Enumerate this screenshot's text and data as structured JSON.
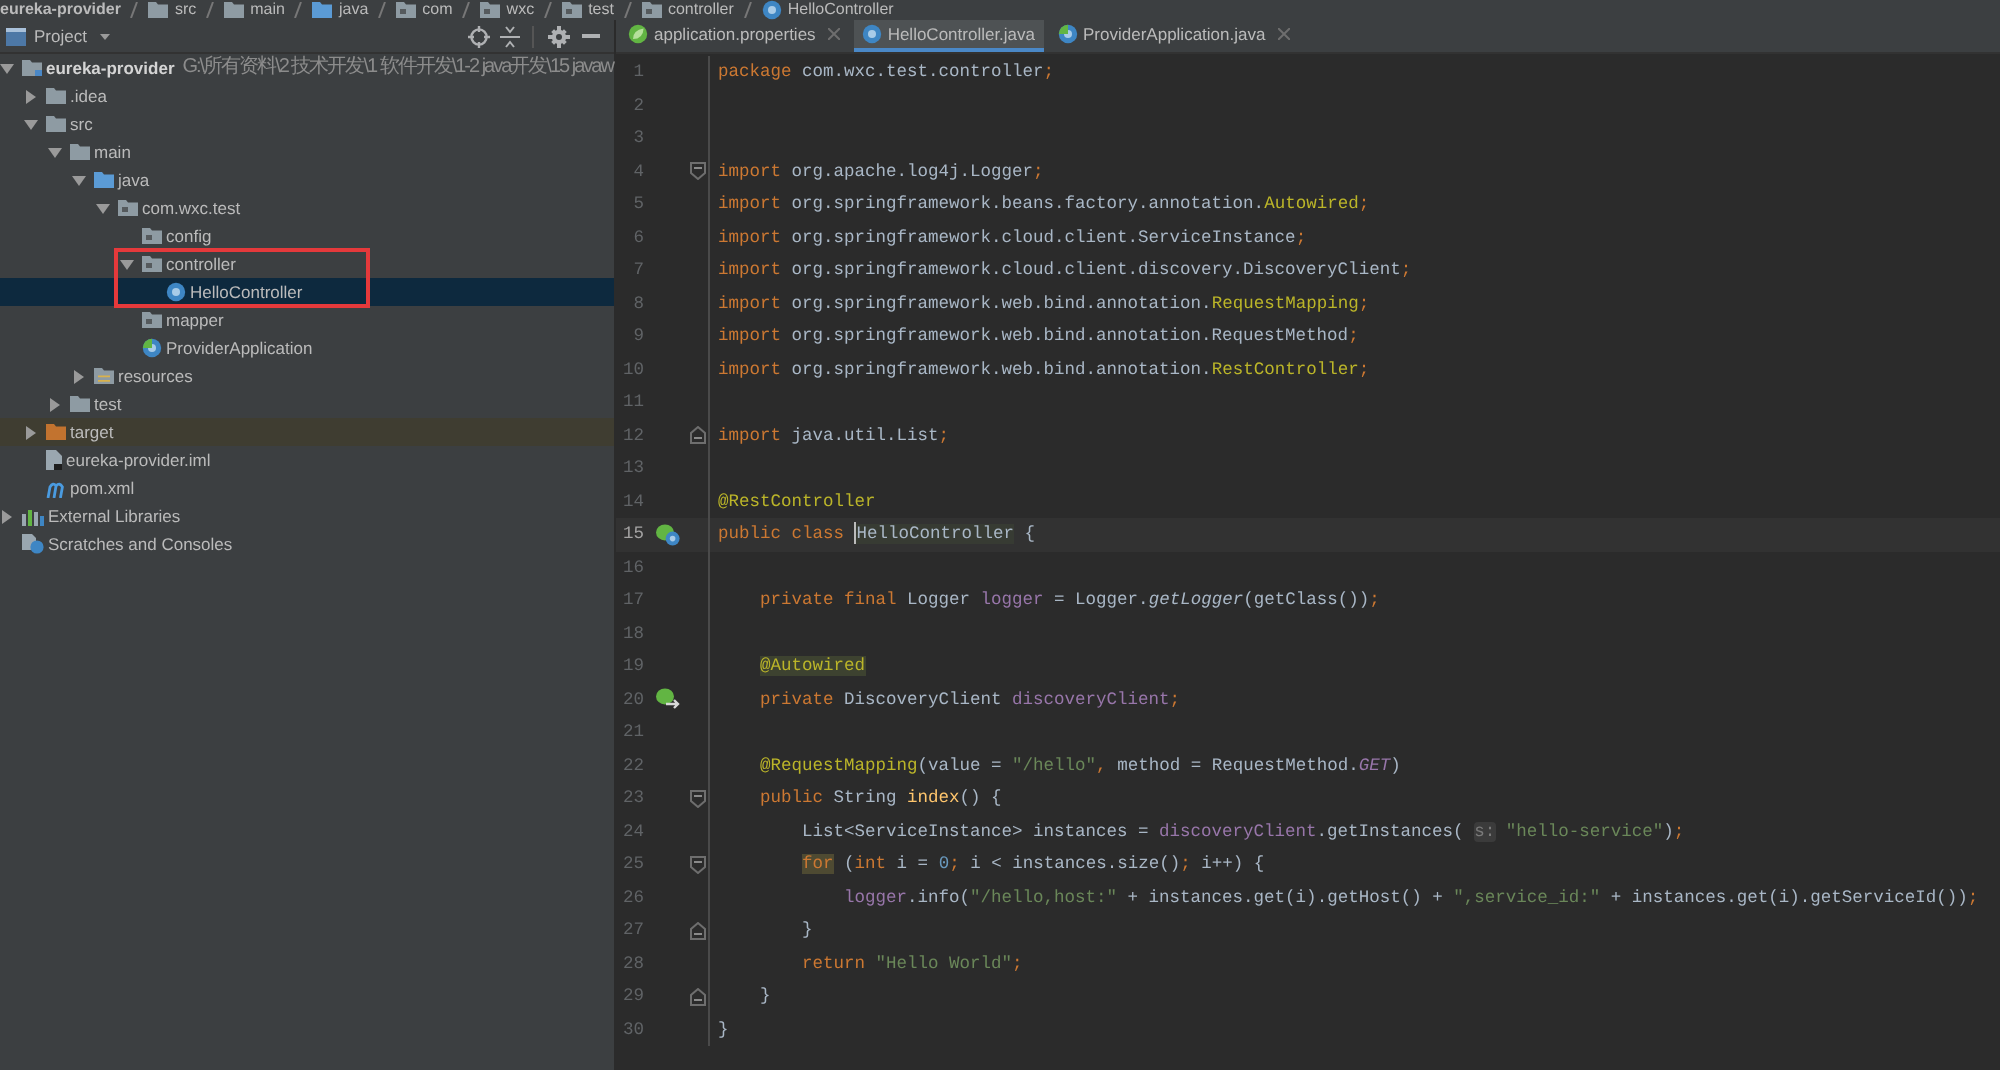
{
  "breadcrumb": [
    {
      "label": "eureka-provider",
      "kind": "module"
    },
    {
      "label": "src",
      "kind": "folder"
    },
    {
      "label": "main",
      "kind": "folder"
    },
    {
      "label": "java",
      "kind": "source"
    },
    {
      "label": "com",
      "kind": "package"
    },
    {
      "label": "wxc",
      "kind": "package"
    },
    {
      "label": "test",
      "kind": "package"
    },
    {
      "label": "controller",
      "kind": "package"
    },
    {
      "label": "HelloController",
      "kind": "class"
    }
  ],
  "project_panel": {
    "title": "Project",
    "tree": [
      {
        "label": "eureka-provider",
        "path": "G:\\所有资料\\2 技术开发\\1 软件开发\\1-2 java开发\\15 javaw",
        "kind": "module",
        "expanded": true,
        "selected": false,
        "annotated": false,
        "children": [
          {
            "label": ".idea",
            "kind": "folder",
            "expanded": false,
            "selected": false,
            "annotated": false
          },
          {
            "label": "src",
            "kind": "folder",
            "expanded": true,
            "selected": false,
            "annotated": false,
            "children": [
              {
                "label": "main",
                "kind": "folder",
                "expanded": true,
                "selected": false,
                "annotated": false,
                "children": [
                  {
                    "label": "java",
                    "kind": "source",
                    "expanded": true,
                    "selected": false,
                    "annotated": false,
                    "children": [
                      {
                        "label": "com.wxc.test",
                        "kind": "package",
                        "expanded": true,
                        "selected": false,
                        "annotated": false,
                        "children": [
                          {
                            "label": "config",
                            "kind": "package",
                            "selected": false,
                            "annotated": false
                          },
                          {
                            "label": "controller",
                            "kind": "package",
                            "expanded": true,
                            "selected": false,
                            "annotated": true,
                            "children": [
                              {
                                "label": "HelloController",
                                "kind": "class",
                                "selected": true,
                                "annotated": true
                              }
                            ]
                          },
                          {
                            "label": "mapper",
                            "kind": "package",
                            "selected": false,
                            "annotated": false
                          },
                          {
                            "label": "ProviderApplication",
                            "kind": "springapp",
                            "selected": false,
                            "annotated": false
                          }
                        ]
                      }
                    ]
                  },
                  {
                    "label": "resources",
                    "kind": "resources",
                    "expanded": false,
                    "selected": false,
                    "annotated": false
                  }
                ]
              },
              {
                "label": "test",
                "kind": "folder",
                "expanded": false,
                "selected": false,
                "annotated": false
              }
            ]
          },
          {
            "label": "target",
            "kind": "excluded",
            "expanded": false,
            "selected": false,
            "annotated": false
          },
          {
            "label": "eureka-provider.iml",
            "kind": "iml",
            "selected": false,
            "annotated": false
          },
          {
            "label": "pom.xml",
            "kind": "maven",
            "selected": false,
            "annotated": false
          }
        ]
      },
      {
        "label": "External Libraries",
        "kind": "libraries",
        "expanded": false,
        "selected": false,
        "annotated": false
      },
      {
        "label": "Scratches and Consoles",
        "kind": "scratches",
        "selected": false,
        "annotated": false
      }
    ]
  },
  "editor": {
    "tabs": [
      {
        "label": "application.properties",
        "kind": "properties",
        "selected": false,
        "closable": true
      },
      {
        "label": "HelloController.java",
        "kind": "class",
        "selected": true,
        "closable": false
      },
      {
        "label": "ProviderApplication.java",
        "kind": "springapp",
        "selected": false,
        "closable": true
      }
    ],
    "lines": [
      {
        "number": "1",
        "kind": "plain",
        "current": false,
        "tokens": [
          {
            "kind": "keyword",
            "text": "package"
          },
          {
            "kind": "plain",
            "text": " com.wxc.test.controller"
          },
          {
            "kind": "keyword",
            "text": ";"
          }
        ]
      },
      {
        "number": "2",
        "kind": "plain",
        "current": false
      },
      {
        "number": "3",
        "kind": "plain",
        "current": false
      },
      {
        "number": "4",
        "kind": "foldstart",
        "current": false,
        "tokens": [
          {
            "kind": "keyword",
            "text": "import"
          },
          {
            "kind": "plain",
            "text": " org.apache.log4j.Logger"
          },
          {
            "kind": "keyword",
            "text": ";"
          }
        ]
      },
      {
        "number": "5",
        "kind": "plain",
        "current": false,
        "tokens": [
          {
            "kind": "keyword",
            "text": "import"
          },
          {
            "kind": "plain",
            "text": " org.springframework.beans.factory.annotation."
          },
          {
            "kind": "annotation",
            "text": "Autowired"
          },
          {
            "kind": "keyword",
            "text": ";"
          }
        ]
      },
      {
        "number": "6",
        "kind": "plain",
        "current": false,
        "tokens": [
          {
            "kind": "keyword",
            "text": "import"
          },
          {
            "kind": "plain",
            "text": " org.springframework.cloud.client.ServiceInstance"
          },
          {
            "kind": "keyword",
            "text": ";"
          }
        ]
      },
      {
        "number": "7",
        "kind": "plain",
        "current": false,
        "tokens": [
          {
            "kind": "keyword",
            "text": "import"
          },
          {
            "kind": "plain",
            "text": " org.springframework.cloud.client.discovery.DiscoveryClient"
          },
          {
            "kind": "keyword",
            "text": ";"
          }
        ]
      },
      {
        "number": "8",
        "kind": "plain",
        "current": false,
        "tokens": [
          {
            "kind": "keyword",
            "text": "import"
          },
          {
            "kind": "plain",
            "text": " org.springframework.web.bind.annotation."
          },
          {
            "kind": "annotation",
            "text": "RequestMapping"
          },
          {
            "kind": "keyword",
            "text": ";"
          }
        ]
      },
      {
        "number": "9",
        "kind": "plain",
        "current": false,
        "tokens": [
          {
            "kind": "keyword",
            "text": "import"
          },
          {
            "kind": "plain",
            "text": " org.springframework.web.bind.annotation.RequestMethod"
          },
          {
            "kind": "keyword",
            "text": ";"
          }
        ]
      },
      {
        "number": "10",
        "kind": "plain",
        "current": false,
        "tokens": [
          {
            "kind": "keyword",
            "text": "import"
          },
          {
            "kind": "plain",
            "text": " org.springframework.web.bind.annotation."
          },
          {
            "kind": "annotation",
            "text": "RestController"
          },
          {
            "kind": "keyword",
            "text": ";"
          }
        ]
      },
      {
        "number": "11",
        "kind": "plain",
        "current": false
      },
      {
        "number": "12",
        "kind": "foldend",
        "current": false,
        "tokens": [
          {
            "kind": "keyword",
            "text": "import"
          },
          {
            "kind": "plain",
            "text": " java.util.List"
          },
          {
            "kind": "keyword",
            "text": ";"
          }
        ]
      },
      {
        "number": "13",
        "kind": "plain",
        "current": false
      },
      {
        "number": "14",
        "kind": "plain",
        "current": false,
        "tokens": [
          {
            "kind": "annotation",
            "text": "@RestController"
          }
        ]
      },
      {
        "number": "15",
        "kind": "classmarker",
        "current": true,
        "tokens": [
          {
            "kind": "keyword",
            "text": "public class "
          },
          {
            "kind": "caret"
          },
          {
            "kind": "markedname",
            "text": "HelloController"
          },
          {
            "kind": "plain",
            "text": " {"
          }
        ],
        "children": [
          {
            "number": "16",
            "kind": "plain",
            "current": false
          },
          {
            "number": "17",
            "kind": "plain",
            "current": false,
            "tokens": [
              {
                "kind": "keyword",
                "text": "private final "
              },
              {
                "kind": "plain",
                "text": "Logger "
              },
              {
                "kind": "field",
                "text": "logger"
              },
              {
                "kind": "plain",
                "text": " = Logger."
              },
              {
                "kind": "static",
                "text": "getLogger"
              },
              {
                "kind": "plain",
                "text": "(getClass())"
              },
              {
                "kind": "keyword",
                "text": ";"
              }
            ]
          },
          {
            "number": "18",
            "kind": "plain",
            "current": false
          },
          {
            "number": "19",
            "kind": "plain",
            "current": false,
            "tokens": [
              {
                "kind": "markedannotation",
                "text": "@Autowired"
              }
            ]
          },
          {
            "number": "20",
            "kind": "autowiredmarker",
            "current": false,
            "tokens": [
              {
                "kind": "keyword",
                "text": "private "
              },
              {
                "kind": "plain",
                "text": "DiscoveryClient "
              },
              {
                "kind": "field",
                "text": "discoveryClient"
              },
              {
                "kind": "keyword",
                "text": ";"
              }
            ]
          },
          {
            "number": "21",
            "kind": "plain",
            "current": false
          },
          {
            "number": "22",
            "kind": "plain",
            "current": false,
            "tokens": [
              {
                "kind": "annotation",
                "text": "@RequestMapping"
              },
              {
                "kind": "plain",
                "text": "(value = "
              },
              {
                "kind": "string",
                "text": "\"/hello\""
              },
              {
                "kind": "keyword",
                "text": ", "
              },
              {
                "kind": "plain",
                "text": "method = RequestMethod."
              },
              {
                "kind": "constant",
                "text": "GET"
              },
              {
                "kind": "plain",
                "text": ")"
              }
            ]
          },
          {
            "number": "23",
            "kind": "foldstart",
            "current": false,
            "tokens": [
              {
                "kind": "keyword",
                "text": "public "
              },
              {
                "kind": "plain",
                "text": "String "
              },
              {
                "kind": "declaration",
                "text": "index"
              },
              {
                "kind": "plain",
                "text": "() {"
              }
            ],
            "children": [
              {
                "number": "24",
                "kind": "plain",
                "current": false,
                "tokens": [
                  {
                    "kind": "plain",
                    "text": "List<ServiceInstance> instances = "
                  },
                  {
                    "kind": "field",
                    "text": "discoveryClient"
                  },
                  {
                    "kind": "plain",
                    "text": ".getInstances( "
                  },
                  {
                    "kind": "hint",
                    "text": "s:"
                  },
                  {
                    "kind": "string",
                    "text": " \"hello-service\""
                  },
                  {
                    "kind": "plain",
                    "text": ")"
                  },
                  {
                    "kind": "keyword",
                    "text": ";"
                  }
                ]
              },
              {
                "number": "25",
                "kind": "foldstart",
                "current": false,
                "tokens": [
                  {
                    "kind": "markedkeyword",
                    "text": "for"
                  },
                  {
                    "kind": "plain",
                    "text": " ("
                  },
                  {
                    "kind": "keyword",
                    "text": "int "
                  },
                  {
                    "kind": "plain",
                    "text": "i = "
                  },
                  {
                    "kind": "number",
                    "text": "0"
                  },
                  {
                    "kind": "keyword",
                    "text": "; "
                  },
                  {
                    "kind": "plain",
                    "text": "i < instances.size()"
                  },
                  {
                    "kind": "keyword",
                    "text": "; "
                  },
                  {
                    "kind": "plain",
                    "text": "i++) {"
                  }
                ],
                "children": [
                  {
                    "number": "26",
                    "current": false,
                    "tokens": [
                      {
                        "kind": "field",
                        "text": "logger"
                      },
                      {
                        "kind": "plain",
                        "text": ".info("
                      },
                      {
                        "kind": "string",
                        "text": "\"/hello,host:\""
                      },
                      {
                        "kind": "plain",
                        "text": " + instances.get(i).getHost() + "
                      },
                      {
                        "kind": "string",
                        "text": "\",service_id:\""
                      },
                      {
                        "kind": "plain",
                        "text": " + instances.get(i).getServiceId())"
                      },
                      {
                        "kind": "keyword",
                        "text": ";"
                      }
                    ]
                  }
                ]
              },
              {
                "number": "27",
                "kind": "foldend",
                "current": false,
                "tokens": [
                  {
                    "kind": "plain",
                    "text": "}"
                  }
                ]
              },
              {
                "number": "28",
                "kind": "plain",
                "current": false,
                "tokens": [
                  {
                    "kind": "keyword",
                    "text": "return "
                  },
                  {
                    "kind": "string",
                    "text": "\"Hello World\""
                  },
                  {
                    "kind": "keyword",
                    "text": ";"
                  }
                ]
              }
            ]
          },
          {
            "number": "29",
            "kind": "foldend",
            "current": false,
            "tokens": [
              {
                "kind": "plain",
                "text": "}"
              }
            ]
          }
        ]
      },
      {
        "number": "30",
        "kind": "plain",
        "current": false,
        "tokens": [
          {
            "kind": "plain",
            "text": "}"
          }
        ]
      }
    ]
  }
}
